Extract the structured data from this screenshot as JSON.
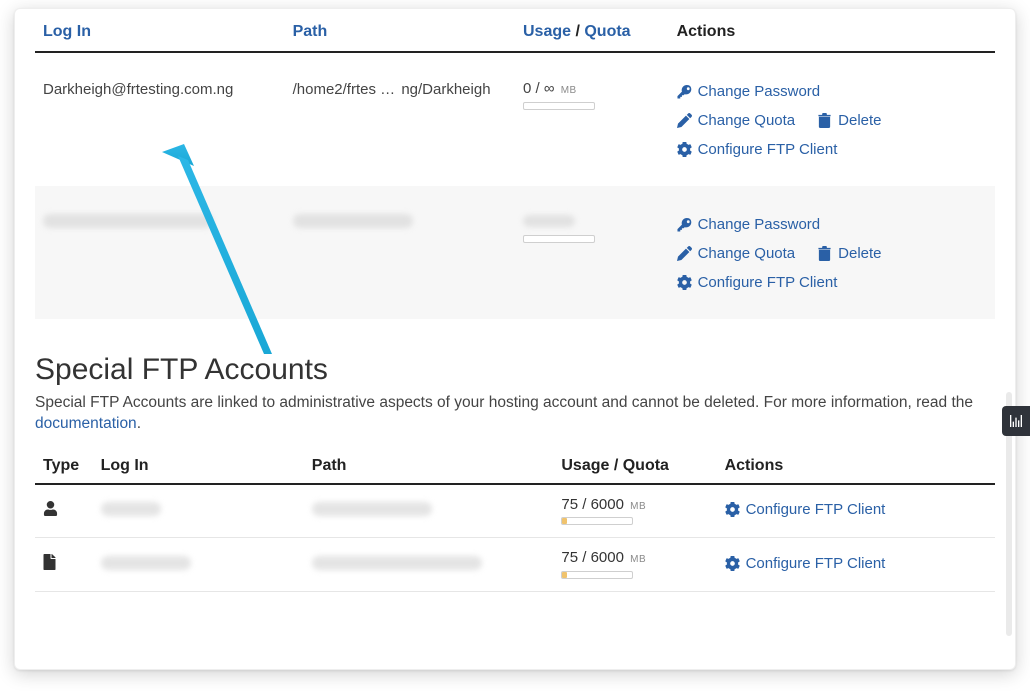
{
  "headers": {
    "login": "Log In",
    "path": "Path",
    "usage": "Usage",
    "quota": "Quota",
    "actions": "Actions",
    "type": "Type",
    "usage_quota": "Usage / Quota"
  },
  "accounts": [
    {
      "login": "Darkheigh@frtesting.com.ng",
      "path_left": "/home2/frtes",
      "path_mid": "…",
      "path_right": "ng/Darkheigh",
      "usage": "0",
      "quota": "∞",
      "unit": "MB"
    }
  ],
  "actions_labels": {
    "change_password": "Change Password",
    "change_quota": "Change Quota",
    "delete": "Delete",
    "configure": "Configure FTP Client"
  },
  "special": {
    "title": "Special FTP Accounts",
    "desc_before": "Special FTP Accounts are linked to administrative aspects of your hosting account and cannot be deleted. For more information, read the ",
    "doc_link": "documentation",
    "desc_after": ".",
    "rows": [
      {
        "usage": "75",
        "quota": "6000",
        "unit": "MB",
        "fill_pct": 6
      },
      {
        "usage": "75",
        "quota": "6000",
        "unit": "MB",
        "fill_pct": 6
      }
    ]
  }
}
